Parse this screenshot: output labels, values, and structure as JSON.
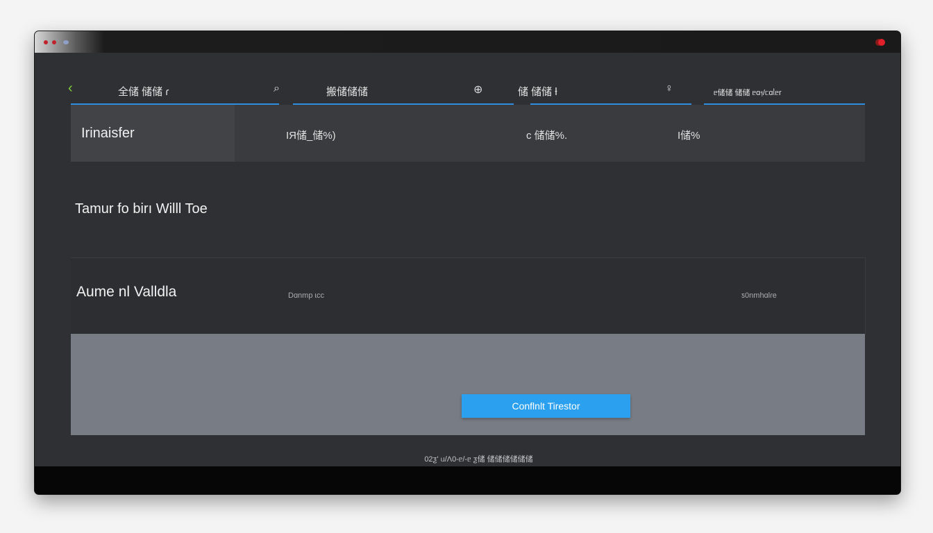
{
  "toolbar": {
    "tab1_label": "全储 储储 ɾ",
    "tab2_label": "搬储储储",
    "tab3_label": "储 储储 ƚ",
    "tab4_label": "ᥱ储储 储储 ᥱɑ᥄/ᥴɑᥣᥱr"
  },
  "summary": {
    "title": "Irinaisfer",
    "value1": "IЯ储_储%)",
    "value2": "ᴄ 储储%.",
    "value3": "I储%"
  },
  "section": {
    "title": "Tamur fo birı Willl   Toe"
  },
  "detail": {
    "title": "Aume nl Valldla",
    "left_small": "Dɑnmp ɩcc",
    "right_small": "ƽ0nmhɑlɾe"
  },
  "action": {
    "confirm_label": "Conflnlt Tirestor"
  },
  "footer": {
    "text": "02ƺ' ᥙ/Ʌ0-ᥱ/-ᥱ ƺ储 储储储储储储"
  },
  "colors": {
    "accent": "#2aa0ef",
    "underline": "#2f8ee0",
    "back_arrow": "#7fd23a",
    "record": "#e0202a"
  },
  "icons": {
    "back": "chevron-left-icon",
    "search": "search-icon",
    "globe": "globe-icon",
    "user": "user-icon"
  }
}
